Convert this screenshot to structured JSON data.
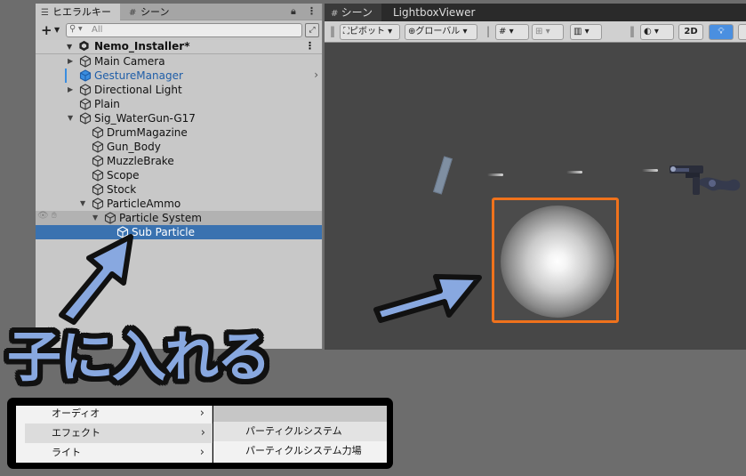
{
  "hierarchy": {
    "tab_label": "ヒエラルキー",
    "tab_scene_label": "シーン",
    "search_placeholder": "All",
    "scene_name": "Nemo_Installer*",
    "items": [
      {
        "label": "Main Camera",
        "depth": 1,
        "expand": "closed"
      },
      {
        "label": "GestureManager",
        "depth": 1,
        "expand": "none",
        "prefab": true
      },
      {
        "label": "Directional Light",
        "depth": 1,
        "expand": "closed"
      },
      {
        "label": "Plain",
        "depth": 1,
        "expand": "none"
      },
      {
        "label": "Sig_WaterGun-G17",
        "depth": 1,
        "expand": "open"
      },
      {
        "label": "DrumMagazine",
        "depth": 2,
        "expand": "none"
      },
      {
        "label": "Gun_Body",
        "depth": 2,
        "expand": "none"
      },
      {
        "label": "MuzzleBrake",
        "depth": 2,
        "expand": "none"
      },
      {
        "label": "Scope",
        "depth": 2,
        "expand": "none"
      },
      {
        "label": "Stock",
        "depth": 2,
        "expand": "none"
      },
      {
        "label": "ParticleAmmo",
        "depth": 2,
        "expand": "open"
      },
      {
        "label": "Particle System",
        "depth": 3,
        "expand": "open",
        "state": "dim"
      },
      {
        "label": "Sub Particle",
        "depth": 4,
        "expand": "none",
        "state": "selected"
      }
    ]
  },
  "scene_view": {
    "tabs": [
      "シーン",
      "LightboxViewer"
    ],
    "toolbar": {
      "pivot": "ピボット",
      "global": "グローバル",
      "mode_2d": "2D"
    }
  },
  "caption": "子に入れる",
  "context_menu": {
    "left_items": [
      "オーディオ",
      "エフェクト",
      "ライト"
    ],
    "right_items": [
      "パーティクルシステム",
      "パーティクルシステム力場"
    ]
  },
  "colors": {
    "selection": "#3a72b0",
    "highlight_border": "#f0721c",
    "arrow_fill": "#88a8e0",
    "prefab_text": "#1f5ea8"
  }
}
